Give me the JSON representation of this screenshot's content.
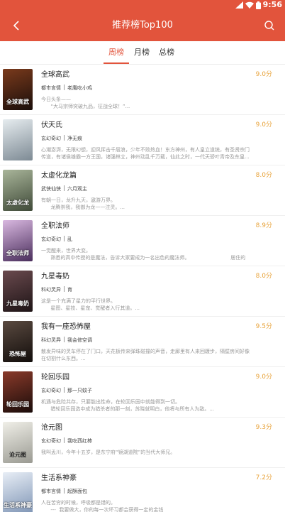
{
  "status_bar": {
    "time": "9:56",
    "color": "#e2543c"
  },
  "header": {
    "title": "推荐榜Top100",
    "back_icon": "chevron-left-icon",
    "search_icon": "search-icon"
  },
  "tabs": [
    {
      "label": "周榜",
      "active": true
    },
    {
      "label": "月榜",
      "active": false
    },
    {
      "label": "总榜",
      "active": false
    }
  ],
  "colors": {
    "accent": "#e2543c",
    "score": "#e8a33b"
  },
  "books": [
    {
      "title": "全球高武",
      "score": "9.0分",
      "category": "都市言情",
      "author": "老鹰吃小鸡",
      "desc": "今日头条——\n      “大马宗师突破九品，征战全球！”...",
      "cover_text": "全球高武",
      "cover_color": "#3a1d12"
    },
    {
      "title": "伏天氏",
      "score": "9.0分",
      "category": "玄幻奇幻",
      "author": "净无痕",
      "desc": "心潮澎湃，无限幻想，迎风挥击千层浪，少年不败热血！东方神州，有人皇立道统，有圣贤宗门\n传道，有诸侯雄霸一方王国，诸强林立，神州动乱千万载，仙此之时，一代天骄叶青帝及东皇...",
      "cover_text": "",
      "cover_color": "#b8c2c8"
    },
    {
      "title": "太虚化龙篇",
      "score": "8.0分",
      "category": "武侠仙侠",
      "author": "六月观主",
      "desc": "有朝一日，龙升九天，遨游万界。\n      龙腾崇我，我御为龙一一注灵。...",
      "cover_text": "太虚化龙",
      "cover_color": "#6b7a5a"
    },
    {
      "title": "全职法师",
      "score": "8.9分",
      "category": "玄幻奇幻",
      "author": "乱",
      "desc": "一觉醒来，世界大变。\n      熟悉的高中传授的是魔法，告诉大家要成为一名出色的魔法师。                          居住的\n...",
      "cover_text": "全职法师",
      "cover_color": "#7a5d8a"
    },
    {
      "title": "九星毒奶",
      "score": "8.0分",
      "category": "科幻灵异",
      "author": "育",
      "desc": "这是一个充满了星力的平行世界。\n      星图、星技、星宠、觉醒者入行其道。...",
      "cover_text": "九星毒奶",
      "cover_color": "#3b2a2e"
    },
    {
      "title": "我有一座恐怖屋",
      "score": "9.5分",
      "category": "科幻灵异",
      "author": "我会修空调",
      "desc": "散发异味的灵车停在了门口，天花板传来弹珠碰撞的声音，走廊里有人来回踱步，隔壁房间好像\n在切割什么东西。...",
      "cover_text": "恐怖屋",
      "cover_color": "#2b2320"
    },
    {
      "title": "轮回乐园",
      "score": "9.0分",
      "category": "玄幻奇幻",
      "author": "那一只蚊子",
      "desc": "机遇与危险共存，只要能出性命，在轮回乐园中就能得到一切。\n      猎轮回乐园选中成为猎杀者的那一刻，苏晓就明白，他将与所有人为敌。...",
      "cover_text": "轮回乐园",
      "cover_color": "#2a1c1c"
    },
    {
      "title": "沧元图",
      "score": "9.3分",
      "category": "玄幻奇幻",
      "author": "我吃西红柿",
      "desc": "我叫孟川，今年十五岁，是东宁府“镜湖道院”的当代大师兄。",
      "cover_text": "沧元图",
      "cover_color": "#d8d8d0"
    },
    {
      "title": "生活系神豪",
      "score": "7.2分",
      "category": "都市言情",
      "author": "起酥面包",
      "desc": "人在苦穷的时候，呼吸都是错的。\n      ---  我要做大，你的每一次坏习都会获得一定的金钱",
      "cover_text": "生活系神豪",
      "cover_color": "#c7d3e3"
    }
  ]
}
